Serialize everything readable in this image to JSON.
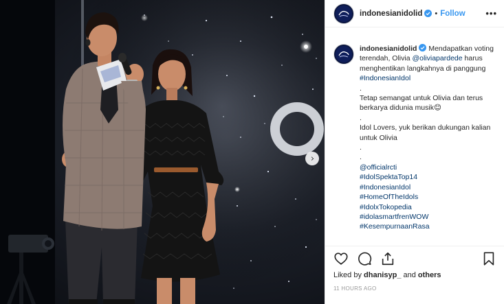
{
  "post": {
    "username": "indonesianidolid",
    "follow_label": "Follow",
    "separator": "•",
    "more_label": "•••"
  },
  "caption": {
    "username": "indonesianidolid",
    "text_1": " Mendapatkan voting terendah, Olivia ",
    "mention_1": "@oliviapardede",
    "text_2": " harus menghentikan langkahnya di panggung ",
    "hashtag_1": "#IndonesianIdol",
    "dot_1": ".",
    "line_2": "Tetap semangat untuk Olivia dan terus berkarya didunia musik",
    "emoji": "😊",
    "dot_2": ".",
    "line_3": "Idol Lovers, yuk berikan dukungan kalian untuk Olivia",
    "dot_3": ".",
    "dot_4": ".",
    "tags": [
      "@officialrcti",
      "#IdolSpektaTop14",
      "#IndonesianIdol",
      "#HomeOfTheIdols",
      "#IdolxTokopedia",
      "#idolasmartfrenWOW",
      "#KesempurnaanRasa"
    ]
  },
  "engagement": {
    "liked_prefix": "Liked by ",
    "liked_user": "dhanisyp_",
    "liked_mid": " and ",
    "liked_others": "others",
    "timestamp": "11 HOURS AGO"
  },
  "icons": {
    "like": "heart-icon",
    "comment": "comment-icon",
    "share": "share-icon",
    "save": "bookmark-icon",
    "next": "chevron-right-icon",
    "verified": "verified-badge-icon"
  },
  "colors": {
    "link": "#003569",
    "follow": "#3897f0",
    "verified": "#3897f0",
    "timestamp": "#999999"
  }
}
